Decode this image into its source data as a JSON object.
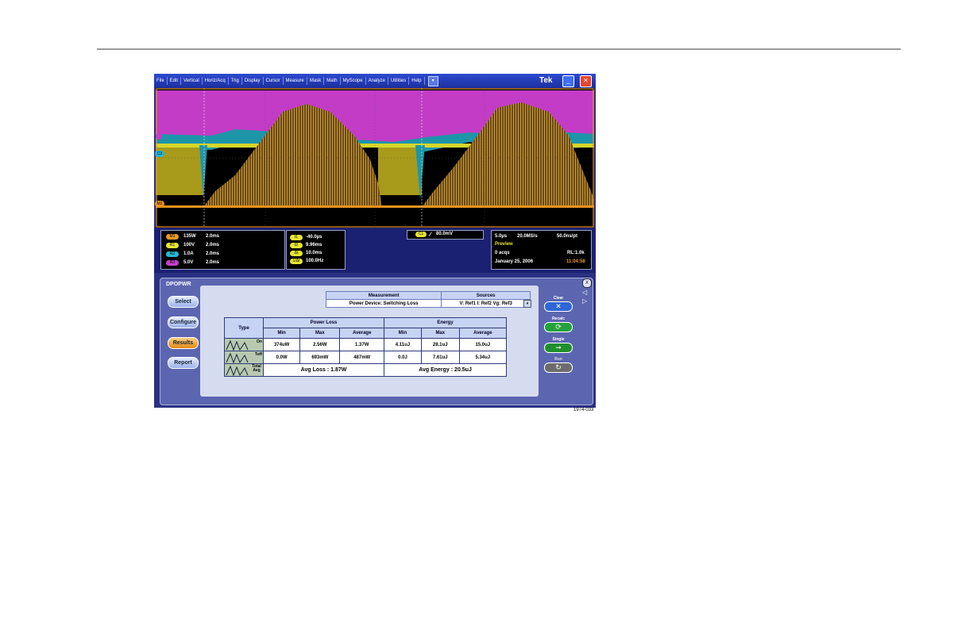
{
  "menubar": {
    "items": [
      "File",
      "Edit",
      "Vertical",
      "Horiz/Acq",
      "Trig",
      "Display",
      "Cursor",
      "Measure",
      "Mask",
      "Math",
      "MyScope",
      "Analyze",
      "Utilities",
      "Help"
    ],
    "brand": "Tek"
  },
  "markers": {
    "m1": "M1",
    "c3": "C3"
  },
  "channels": [
    {
      "badge": "M1",
      "scale": "135W",
      "time": "2.0ms",
      "color": "#e89a2a"
    },
    {
      "badge": "R1",
      "scale": "100V",
      "time": "2.0ms",
      "color": "#e6e633"
    },
    {
      "badge": "R2",
      "scale": "1.0A",
      "time": "2.0ms",
      "color": "#24b8d6"
    },
    {
      "badge": "R3",
      "scale": "5.0V",
      "time": "2.0ms",
      "color": "#c43ec8"
    }
  ],
  "cursors": [
    {
      "badge": "t1",
      "value": "-40.0µs"
    },
    {
      "badge": "t2",
      "value": "9.96ms"
    },
    {
      "badge": "Δt",
      "value": "10.0ms"
    },
    {
      "badge": "1/Δt",
      "value": "100.0Hz"
    }
  ],
  "trigger": {
    "badge": "C1",
    "level": "80.0mV"
  },
  "acq": {
    "horiz": "5.0µs",
    "rate": "20.0MS/s",
    "resolution": "50.0ns/pt",
    "mode": "Preview",
    "acqs": "0 acqs",
    "record": "RL:1.0k",
    "date": "January 25, 2006",
    "time": "11:04:58"
  },
  "panel": {
    "title": "DPOPWR",
    "nav": [
      "Select",
      "Configure",
      "Results",
      "Report"
    ],
    "meas_headers": [
      "Measurement",
      "Sources"
    ],
    "meas_row": [
      "Power Device: Switching Loss",
      "V: Ref1  I: Ref2  Vg: Ref3"
    ],
    "results": {
      "type_label": "Type",
      "group_headers": [
        "Power Loss",
        "Energy"
      ],
      "sub_headers": [
        "Min",
        "Max",
        "Average",
        "Min",
        "Max",
        "Average"
      ],
      "rows": [
        {
          "type": "On",
          "values": [
            "374uW",
            "2.56W",
            "1.37W",
            "4.11uJ",
            "28.1uJ",
            "15.0uJ"
          ]
        },
        {
          "type": "Toff",
          "values": [
            "0.0W",
            "693mW",
            "487mW",
            "0.0J",
            "7.61uJ",
            "5.34uJ"
          ]
        }
      ],
      "total_label": "Total Avg",
      "avg_loss": "Avg Loss : 1.87W",
      "avg_energy": "Avg Energy : 20.5uJ"
    },
    "side": [
      {
        "label": "Clear",
        "icon": "✕",
        "color": "#2f66d8"
      },
      {
        "label": "Recalc",
        "icon": "⟳",
        "color": "#24a23a"
      },
      {
        "label": "Single",
        "icon": "➞",
        "color": "#1f8f2e"
      },
      {
        "label": "Run",
        "icon": "↻",
        "color": "#6c6c6c"
      }
    ]
  },
  "caption": "1974-033"
}
